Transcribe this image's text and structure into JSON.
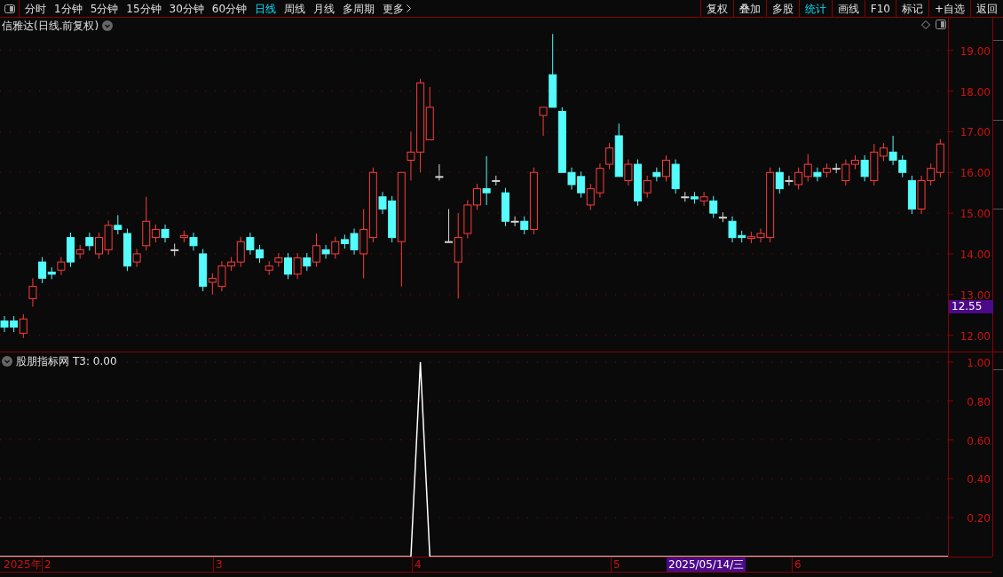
{
  "toolbar": {
    "periods": [
      {
        "label": "分时",
        "selected": false
      },
      {
        "label": "1分钟",
        "selected": false
      },
      {
        "label": "5分钟",
        "selected": false
      },
      {
        "label": "15分钟",
        "selected": false
      },
      {
        "label": "30分钟",
        "selected": false
      },
      {
        "label": "60分钟",
        "selected": false
      },
      {
        "label": "日线",
        "selected": true
      },
      {
        "label": "周线",
        "selected": false
      },
      {
        "label": "月线",
        "selected": false
      },
      {
        "label": "多周期",
        "selected": false
      }
    ],
    "more": "更多",
    "buttons": [
      {
        "label": "复权",
        "active": false
      },
      {
        "label": "叠加",
        "active": false
      },
      {
        "label": "多股",
        "active": false
      },
      {
        "label": "统计",
        "active": true
      },
      {
        "label": "画线",
        "active": false
      },
      {
        "label": "F10",
        "active": false
      },
      {
        "label": "标记",
        "active": false
      },
      {
        "label": "+自选",
        "active": false
      },
      {
        "label": "返回",
        "active": false
      }
    ]
  },
  "main_chart": {
    "title": "信雅达(日线.前复权)",
    "current_price": "12.55",
    "chart_data": {
      "type": "candlestick",
      "ylim": [
        11.6,
        19.8
      ],
      "grid": true,
      "yticks": [
        {
          "value": 19,
          "label": "19.00"
        },
        {
          "value": 18,
          "label": "18.00"
        },
        {
          "value": 17,
          "label": "17.00"
        },
        {
          "value": 16,
          "label": "16.00"
        },
        {
          "value": 15,
          "label": "15.00"
        },
        {
          "value": 14,
          "label": "14.00"
        },
        {
          "value": 13,
          "label": "13.00"
        },
        {
          "value": 12,
          "label": "12.00"
        }
      ],
      "ohlc": [
        [
          12.35,
          12.47,
          12.08,
          12.2
        ],
        [
          12.35,
          12.47,
          12.08,
          12.2
        ],
        [
          12.05,
          12.52,
          11.93,
          12.4
        ],
        [
          12.9,
          13.4,
          12.7,
          13.2
        ],
        [
          13.8,
          13.92,
          13.28,
          13.4
        ],
        [
          13.55,
          13.67,
          13.38,
          13.5
        ],
        [
          13.6,
          13.92,
          13.48,
          13.8
        ],
        [
          14.4,
          14.52,
          13.68,
          13.8
        ],
        [
          14.0,
          14.22,
          13.88,
          14.1
        ],
        [
          14.4,
          14.52,
          14.08,
          14.2
        ],
        [
          14.0,
          14.52,
          13.88,
          14.4
        ],
        [
          14.1,
          14.82,
          13.98,
          14.7
        ],
        [
          14.7,
          14.95,
          14.48,
          14.6
        ],
        [
          14.5,
          14.62,
          13.58,
          13.7
        ],
        [
          13.8,
          14.12,
          13.68,
          14.0
        ],
        [
          14.2,
          15.4,
          14.08,
          14.8
        ],
        [
          14.4,
          14.72,
          14.28,
          14.6
        ],
        [
          14.6,
          14.72,
          14.28,
          14.4
        ],
        [
          14.1,
          14.25,
          13.95,
          14.1
        ],
        [
          14.4,
          14.57,
          14.28,
          14.45
        ],
        [
          14.4,
          14.52,
          14.08,
          14.2
        ],
        [
          14.0,
          14.12,
          13.08,
          13.2
        ],
        [
          13.3,
          13.52,
          13.0,
          13.4
        ],
        [
          13.2,
          13.82,
          13.08,
          13.7
        ],
        [
          13.7,
          13.92,
          13.58,
          13.8
        ],
        [
          13.8,
          14.42,
          13.68,
          14.3
        ],
        [
          14.4,
          14.52,
          13.98,
          14.1
        ],
        [
          14.1,
          14.22,
          13.78,
          13.9
        ],
        [
          13.6,
          13.82,
          13.48,
          13.7
        ],
        [
          13.8,
          14.02,
          13.68,
          13.9
        ],
        [
          13.9,
          14.02,
          13.38,
          13.5
        ],
        [
          13.5,
          14.02,
          13.38,
          13.9
        ],
        [
          13.9,
          14.02,
          13.58,
          13.7
        ],
        [
          13.8,
          14.5,
          13.68,
          14.2
        ],
        [
          14.1,
          14.22,
          13.88,
          14.0
        ],
        [
          14.0,
          14.42,
          13.88,
          14.3
        ],
        [
          14.35,
          14.47,
          14.13,
          14.25
        ],
        [
          14.5,
          14.62,
          13.98,
          14.1
        ],
        [
          14.0,
          15.1,
          13.4,
          14.6
        ],
        [
          14.4,
          16.12,
          14.28,
          16.0
        ],
        [
          15.4,
          15.52,
          14.98,
          15.1
        ],
        [
          15.3,
          15.42,
          14.28,
          14.4
        ],
        [
          14.3,
          16.0,
          13.2,
          16.0
        ],
        [
          16.3,
          17.0,
          15.8,
          16.5
        ],
        [
          16.5,
          18.3,
          16.0,
          18.2
        ],
        [
          16.8,
          18.1,
          16.8,
          17.6
        ],
        [
          15.9,
          16.2,
          15.8,
          15.9
        ],
        [
          14.3,
          15.1,
          14.3,
          14.3
        ],
        [
          13.8,
          15.0,
          12.9,
          14.4
        ],
        [
          14.5,
          15.32,
          14.38,
          15.2
        ],
        [
          15.2,
          15.72,
          15.08,
          15.6
        ],
        [
          15.6,
          16.4,
          15.2,
          15.5
        ],
        [
          15.8,
          15.92,
          15.68,
          15.8
        ],
        [
          15.5,
          15.62,
          14.68,
          14.8
        ],
        [
          14.8,
          14.92,
          14.68,
          14.8
        ],
        [
          14.8,
          14.92,
          14.48,
          14.6
        ],
        [
          14.6,
          16.12,
          14.48,
          16.0
        ],
        [
          17.4,
          17.6,
          16.9,
          17.6
        ],
        [
          18.4,
          19.4,
          17.6,
          17.6
        ],
        [
          17.5,
          17.6,
          16.0,
          16.0
        ],
        [
          16.0,
          16.12,
          15.58,
          15.7
        ],
        [
          15.9,
          16.02,
          15.38,
          15.5
        ],
        [
          15.2,
          15.72,
          15.08,
          15.6
        ],
        [
          15.5,
          16.22,
          15.38,
          16.1
        ],
        [
          16.2,
          16.72,
          16.08,
          16.6
        ],
        [
          16.9,
          17.2,
          15.9,
          15.9
        ],
        [
          15.8,
          16.32,
          15.68,
          16.2
        ],
        [
          16.2,
          16.32,
          15.18,
          15.3
        ],
        [
          15.5,
          15.92,
          15.38,
          15.8
        ],
        [
          16.0,
          16.12,
          15.78,
          15.9
        ],
        [
          15.9,
          16.42,
          15.78,
          16.3
        ],
        [
          16.2,
          16.32,
          15.48,
          15.6
        ],
        [
          15.4,
          15.52,
          15.28,
          15.4
        ],
        [
          15.4,
          15.52,
          15.23,
          15.35
        ],
        [
          15.3,
          15.52,
          15.18,
          15.4
        ],
        [
          15.3,
          15.42,
          14.88,
          15.0
        ],
        [
          14.9,
          15.02,
          14.78,
          14.9
        ],
        [
          14.8,
          14.92,
          14.28,
          14.4
        ],
        [
          14.45,
          14.57,
          14.28,
          14.4
        ],
        [
          14.38,
          14.54,
          14.26,
          14.42
        ],
        [
          14.4,
          14.62,
          14.28,
          14.5
        ],
        [
          14.4,
          16.12,
          14.28,
          16.0
        ],
        [
          16.0,
          16.12,
          15.48,
          15.6
        ],
        [
          15.8,
          15.92,
          15.68,
          15.8
        ],
        [
          15.7,
          16.12,
          15.58,
          16.0
        ],
        [
          15.9,
          16.45,
          15.78,
          16.2
        ],
        [
          16.0,
          16.12,
          15.78,
          15.9
        ],
        [
          16.0,
          16.22,
          15.88,
          16.1
        ],
        [
          16.1,
          16.22,
          15.98,
          16.1
        ],
        [
          15.8,
          16.32,
          15.68,
          16.2
        ],
        [
          16.2,
          16.42,
          16.08,
          16.3
        ],
        [
          16.3,
          16.42,
          15.78,
          15.9
        ],
        [
          15.8,
          16.7,
          15.68,
          16.5
        ],
        [
          16.4,
          16.72,
          16.28,
          16.6
        ],
        [
          16.5,
          16.9,
          16.18,
          16.3
        ],
        [
          16.3,
          16.42,
          15.88,
          16.0
        ],
        [
          15.8,
          15.92,
          14.98,
          15.1
        ],
        [
          15.1,
          15.92,
          14.98,
          15.8
        ],
        [
          15.8,
          16.22,
          15.68,
          16.1
        ],
        [
          16.0,
          16.82,
          15.88,
          16.7
        ]
      ]
    }
  },
  "indicator": {
    "name": "股朋指标网",
    "reading": "T3: 0.00",
    "chart_data": {
      "type": "line",
      "ylim": [
        0,
        1.05
      ],
      "grid": true,
      "yticks": [
        {
          "value": 1,
          "label": "1.00"
        },
        {
          "value": 0.8,
          "label": "0.80"
        },
        {
          "value": 0.6,
          "label": "0.60"
        },
        {
          "value": 0.4,
          "label": "0.40"
        },
        {
          "value": 0.2,
          "label": "0.20"
        }
      ],
      "series": [
        {
          "color": "#ffffff",
          "values": [
            0,
            0,
            0,
            0,
            0,
            0,
            0,
            0,
            0,
            0,
            0,
            0,
            0,
            0,
            0,
            0,
            0,
            0,
            0,
            0,
            0,
            0,
            0,
            0,
            0,
            0,
            0,
            0,
            0,
            0,
            0,
            0,
            0,
            0,
            0,
            0,
            0,
            0,
            0,
            0,
            0,
            0,
            0,
            0,
            1,
            0,
            0,
            0,
            0,
            0,
            0,
            0,
            0,
            0,
            0,
            0,
            0,
            0,
            0,
            0,
            0,
            0,
            0,
            0,
            0,
            0,
            0,
            0,
            0,
            0,
            0,
            0,
            0,
            0,
            0,
            0,
            0,
            0,
            0,
            0,
            0,
            0,
            0,
            0,
            0,
            0,
            0,
            0,
            0,
            0,
            0,
            0,
            0,
            0,
            0,
            0,
            0,
            0,
            0,
            0
          ]
        }
      ]
    }
  },
  "date_axis": [
    {
      "label": "2025年",
      "kind": "year"
    },
    {
      "label": "2",
      "kind": "month"
    },
    {
      "label": "3",
      "kind": "month"
    },
    {
      "label": "4",
      "kind": "month"
    },
    {
      "label": "5",
      "kind": "month"
    },
    {
      "label": "2025/05/14/三",
      "kind": "cursor"
    },
    {
      "label": "6",
      "kind": "month"
    }
  ]
}
